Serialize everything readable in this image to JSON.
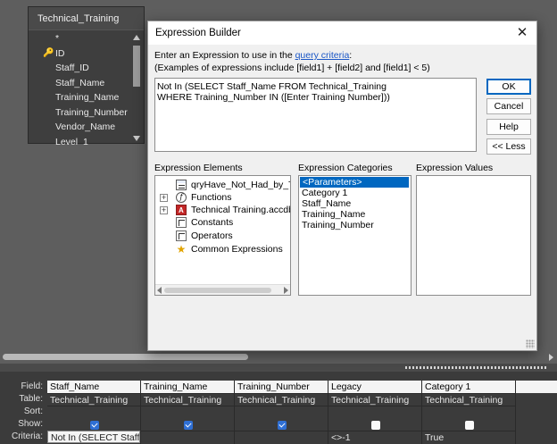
{
  "field_list": {
    "title": "Technical_Training",
    "fields": [
      "*",
      "ID",
      "Staff_ID",
      "Staff_Name",
      "Training_Name",
      "Training_Number",
      "Vendor_Name",
      "Level_1"
    ]
  },
  "dialog": {
    "title": "Expression Builder",
    "instruction_prefix": "Enter an Expression to use in the ",
    "instruction_link": "query criteria",
    "instruction_suffix": ":",
    "examples": "(Examples of expressions include [field1] + [field2] and [field1] < 5)",
    "expression": "Not In (SELECT Staff_Name FROM Technical_Training\nWHERE Training_Number IN ([Enter Training Number]))",
    "buttons": {
      "ok": "OK",
      "cancel": "Cancel",
      "help": "Help",
      "less": "<< Less"
    },
    "elements_label": "Expression Elements",
    "categories_label": "Expression Categories",
    "values_label": "Expression Values",
    "elements": [
      "qryHave_Not_Had_by_Training",
      "Functions",
      "Technical Training.accdb",
      "Constants",
      "Operators",
      "Common Expressions"
    ],
    "categories": [
      "<Parameters>",
      "Category 1",
      "Staff_Name",
      "Training_Name",
      "Training_Number"
    ]
  },
  "grid": {
    "row_labels": {
      "field": "Field:",
      "table": "Table:",
      "sort": "Sort:",
      "show": "Show:",
      "criteria": "Criteria:"
    },
    "columns": [
      {
        "field": "Staff_Name",
        "table": "Technical_Training",
        "show": true,
        "criteria": "Not In (SELECT Staff_N"
      },
      {
        "field": "Training_Name",
        "table": "Technical_Training",
        "show": true,
        "criteria": ""
      },
      {
        "field": "Training_Number",
        "table": "Technical_Training",
        "show": true,
        "criteria": ""
      },
      {
        "field": "Legacy",
        "table": "Technical_Training",
        "show": false,
        "criteria": "<>-1"
      },
      {
        "field": "Category 1",
        "table": "Technical_Training",
        "show": false,
        "criteria": "True"
      }
    ]
  },
  "colors": {
    "accent": "#0067c0",
    "checkbox": "#2f6fd4",
    "background": "#5e5e5e"
  }
}
